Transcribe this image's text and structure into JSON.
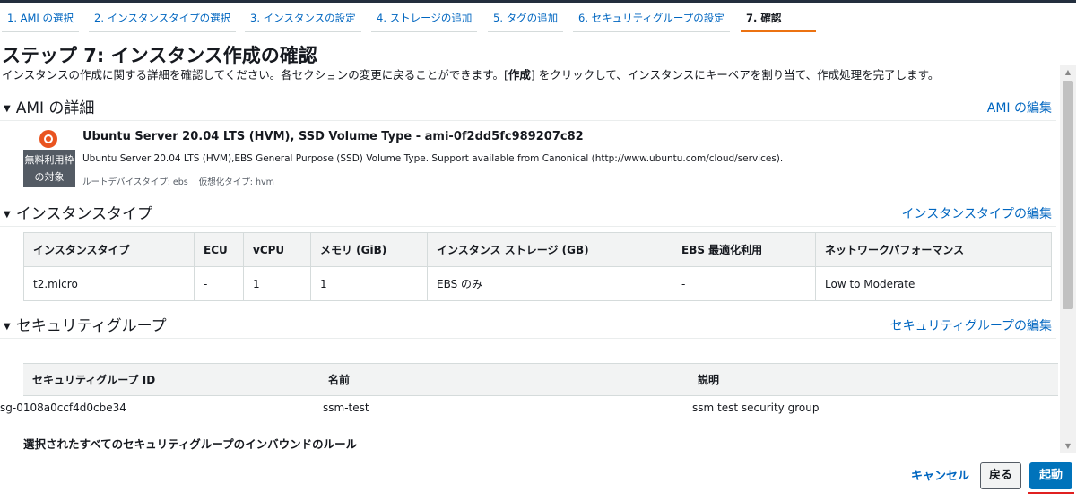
{
  "steps": [
    {
      "label": "1. AMI の選択"
    },
    {
      "label": "2. インスタンスタイプの選択"
    },
    {
      "label": "3. インスタンスの設定"
    },
    {
      "label": "4. ストレージの追加"
    },
    {
      "label": "5. タグの追加"
    },
    {
      "label": "6. セキュリティグループの設定"
    },
    {
      "label": "7. 確認"
    }
  ],
  "page": {
    "title": "ステップ 7: インスタンス作成の確認",
    "desc_before": "インスタンスの作成に関する詳細を確認してください。各セクションの変更に戻ることができます。[",
    "desc_bold": "作成",
    "desc_after": "] をクリックして、インスタンスにキーペアを割り当て、作成処理を完了します。"
  },
  "ami": {
    "title": "AMI の詳細",
    "edit_link": "AMI の編集",
    "name": "Ubuntu Server 20.04 LTS (HVM), SSD Volume Type - ami-0f2dd5fc989207c82",
    "description": "Ubuntu Server 20.04 LTS (HVM),EBS General Purpose (SSD) Volume Type. Support available from Canonical (http://www.ubuntu.com/cloud/services).",
    "free_tier_line1": "無料利用枠",
    "free_tier_line2": "の対象",
    "root_device": "ルートデバイスタイプ: ebs",
    "virtualization": "仮想化タイプ: hvm"
  },
  "instance_type": {
    "title": "インスタンスタイプ",
    "edit_link": "インスタンスタイプの編集",
    "headers": [
      "インスタンスタイプ",
      "ECU",
      "vCPU",
      "メモリ (GiB)",
      "インスタンス ストレージ (GB)",
      "EBS 最適化利用",
      "ネットワークパフォーマンス"
    ],
    "row": [
      "t2.micro",
      "-",
      "1",
      "1",
      "EBS のみ",
      "-",
      "Low to Moderate"
    ]
  },
  "security_group": {
    "title": "セキュリティグループ",
    "edit_link": "セキュリティグループの編集",
    "headers": [
      "セキュリティグループ ID",
      "名前",
      "説明"
    ],
    "row": [
      "sg-0108a0ccf4d0cbe34",
      "ssm-test",
      "ssm test security group"
    ],
    "inbound_title": "選択されたすべてのセキュリティグループのインバウンドのルール"
  },
  "footer": {
    "cancel": "キャンセル",
    "back": "戻る",
    "launch": "起動"
  }
}
